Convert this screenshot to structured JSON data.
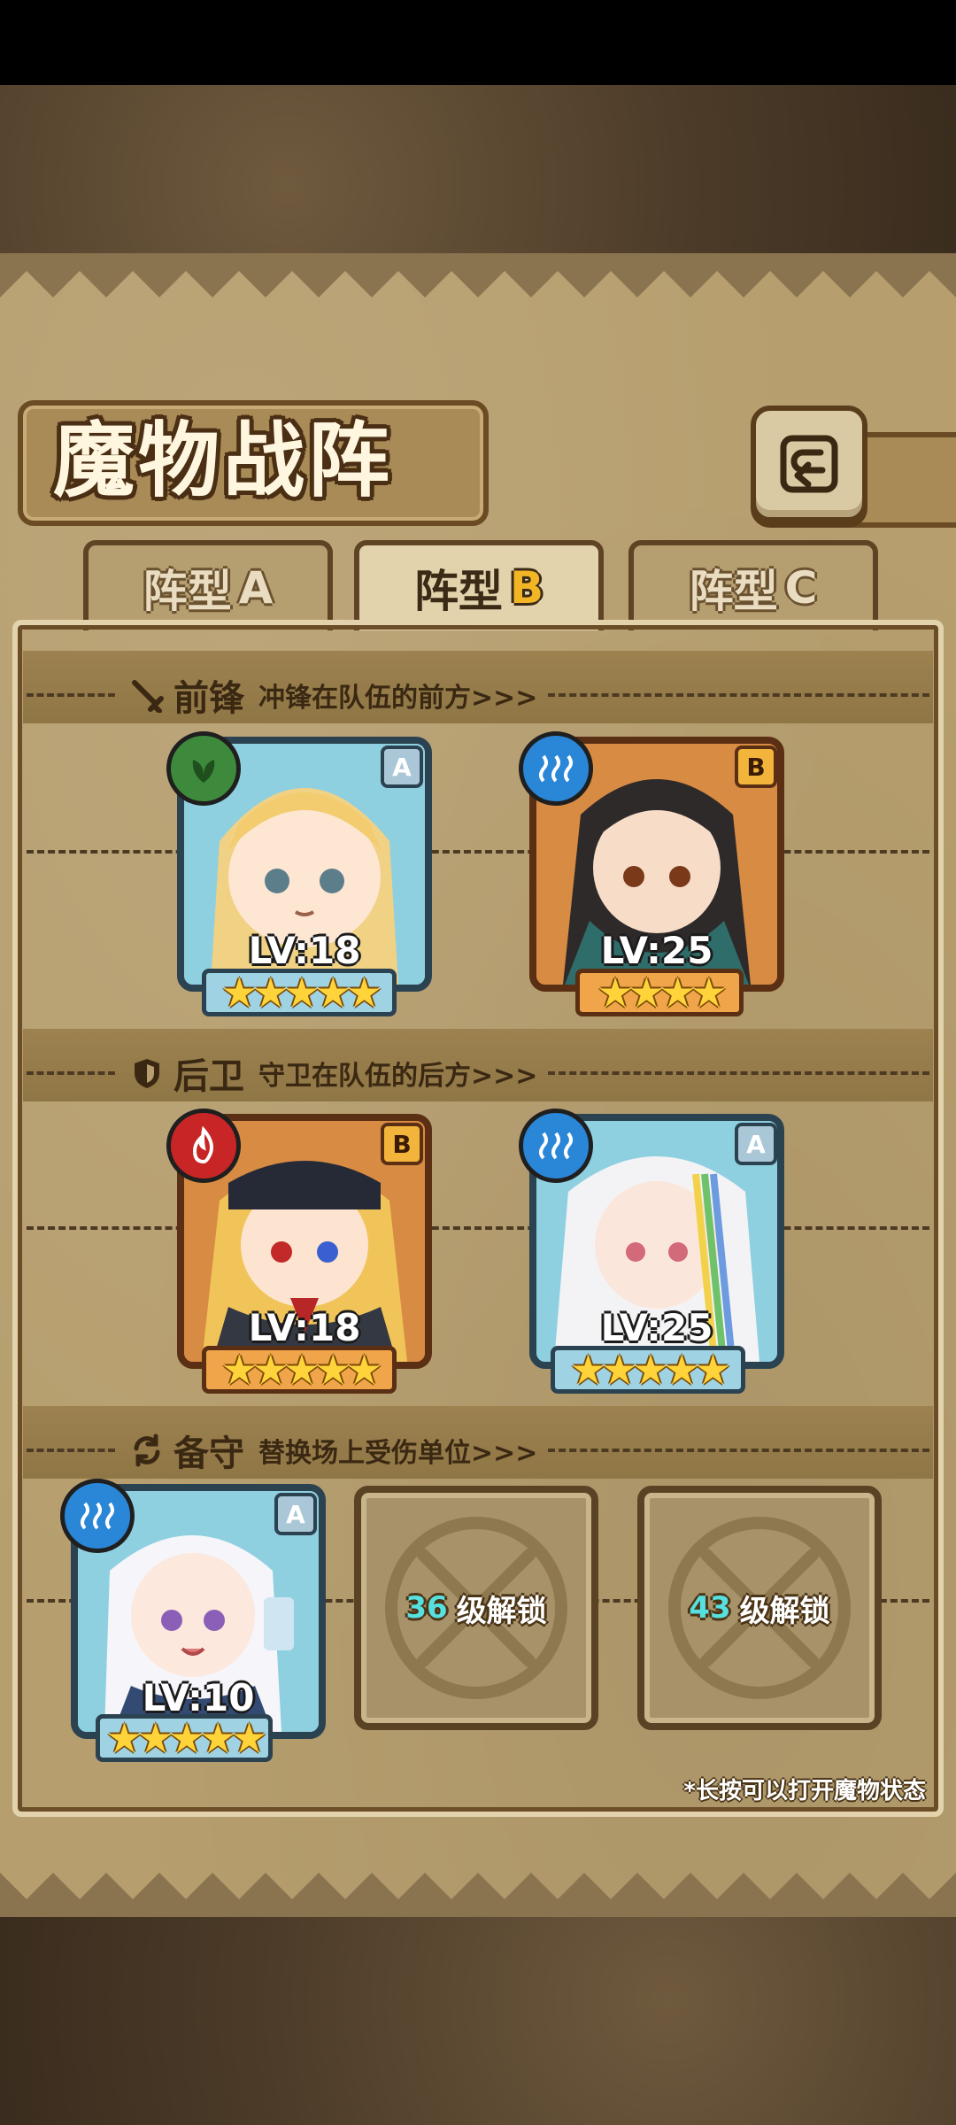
{
  "title": "魔物战阵",
  "tabs": [
    {
      "label": "阵型",
      "letter": "A",
      "active": false
    },
    {
      "label": "阵型",
      "letter": "B",
      "active": true
    },
    {
      "label": "阵型",
      "letter": "C",
      "active": false
    }
  ],
  "sections": {
    "front": {
      "title": "前锋",
      "desc": "冲锋在队伍的前方>>>",
      "icon": "sword-icon"
    },
    "rear": {
      "title": "后卫",
      "desc": "守卫在队伍的后方>>>",
      "icon": "shield-icon"
    },
    "reserve": {
      "title": "备守",
      "desc": "替换场上受伤单位>>>",
      "icon": "swap-icon"
    }
  },
  "monsters": {
    "front1": {
      "level": "LV:18",
      "rank": "A",
      "element": "plant",
      "stars": "★★★★★"
    },
    "front2": {
      "level": "LV:25",
      "rank": "B",
      "element": "water",
      "stars": "★★★★"
    },
    "rear1": {
      "level": "LV:18",
      "rank": "B",
      "element": "fire",
      "stars": "★★★★★"
    },
    "rear2": {
      "level": "LV:25",
      "rank": "A",
      "element": "water",
      "stars": "★★★★★"
    },
    "reserve1": {
      "level": "LV:10",
      "rank": "A",
      "element": "water",
      "stars": "★★★★★"
    }
  },
  "locked_slots": [
    {
      "level": "36",
      "text": "级解锁"
    },
    {
      "level": "43",
      "text": "级解锁"
    }
  ],
  "footnote": "*长按可以打开魔物状态",
  "colors": {
    "accent_gold": "#f1b525",
    "unlock_cyan": "#56e0df"
  }
}
